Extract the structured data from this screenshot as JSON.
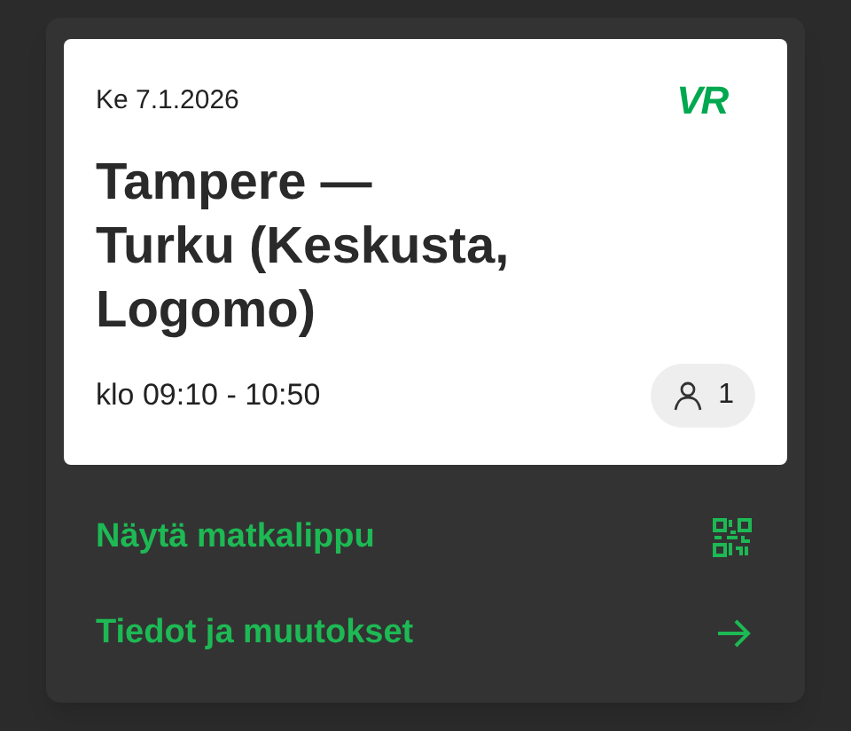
{
  "ticket": {
    "date": "Ke 7.1.2026",
    "logo": "VR",
    "route": "Tampere —\nTurku (Keskusta,\nLogomo)",
    "time": "klo 09:10 - 10:50",
    "passengers": "1"
  },
  "actions": [
    {
      "kind": "qr",
      "label": "Näytä matkalippu"
    },
    {
      "kind": "arrow",
      "label": "Tiedot ja muutokset"
    }
  ]
}
